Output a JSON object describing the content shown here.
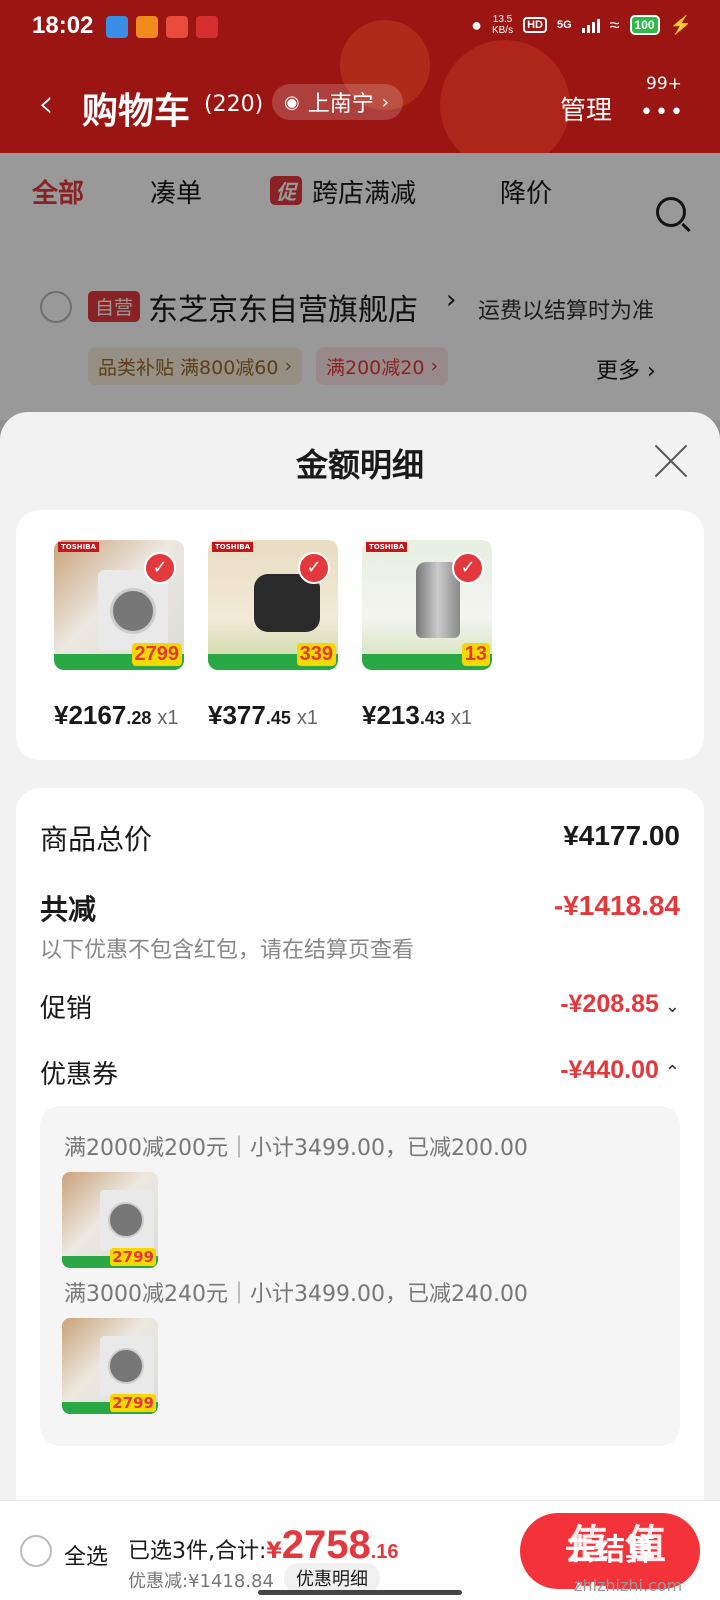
{
  "status_bar": {
    "time": "18:02",
    "net_speed": "13.5",
    "net_unit": "KB/s",
    "hd": "HD",
    "network": "5G",
    "battery": "100"
  },
  "header": {
    "title": "购物车",
    "count": "(220)",
    "location": "上南宁",
    "location_icon": "eye-icon",
    "manage": "管理",
    "message_badge": "99+"
  },
  "tabs": [
    {
      "label": "全部",
      "active": true
    },
    {
      "label": "凑单"
    },
    {
      "label": "跨店满减",
      "tag": "促"
    },
    {
      "label": "降价"
    }
  ],
  "store": {
    "tag": "自营",
    "name": "东芝京东自营旗舰店",
    "shipping_note": "运费以结算时为准",
    "coupons": [
      "品类补贴 满800减60",
      "满200减20"
    ],
    "more": "更多"
  },
  "sheet": {
    "title": "金额明细",
    "products": [
      {
        "price_int": "¥2167",
        "price_dec": ".28",
        "qty": "x1",
        "thumb_price": "2799",
        "kind": "washer"
      },
      {
        "price_int": "¥377",
        "price_dec": ".45",
        "qty": "x1",
        "thumb_price": "339",
        "kind": "rice-cooker"
      },
      {
        "price_int": "¥213",
        "price_dec": ".43",
        "qty": "x1",
        "thumb_price": "13",
        "kind": "kettle"
      }
    ],
    "summary": {
      "total_label": "商品总价",
      "total_value": "¥4177.00",
      "reduce_label": "共减",
      "reduce_value": "-¥1418.84",
      "reduce_note": "以下优惠不包含红包，请在结算页查看",
      "promo_label": "促销",
      "promo_value": "-¥208.85",
      "coupon_label": "优惠券",
      "coupon_value": "-¥440.00"
    },
    "coupon_details": [
      {
        "text": "满2000减200元｜小计3499.00，已减200.00",
        "thumb_price": "2799"
      },
      {
        "text": "满3000减240元｜小计3499.00，已减240.00",
        "thumb_price": "2799"
      }
    ]
  },
  "bottom_bar": {
    "select_all": "全选",
    "selected_prefix": "已选3件,合计:",
    "currency": "¥",
    "total_int": "2758",
    "total_dec": ".16",
    "discount": "优惠减:¥1418.84",
    "detail_button": "优惠明细",
    "checkout": "去结算",
    "watermark": "值 值 值",
    "watermark_url": "zhizhizhi.com"
  },
  "colors": {
    "header_red": "#9b1513",
    "accent_red": "#e4393c",
    "checkout_red": "#f4323a"
  }
}
